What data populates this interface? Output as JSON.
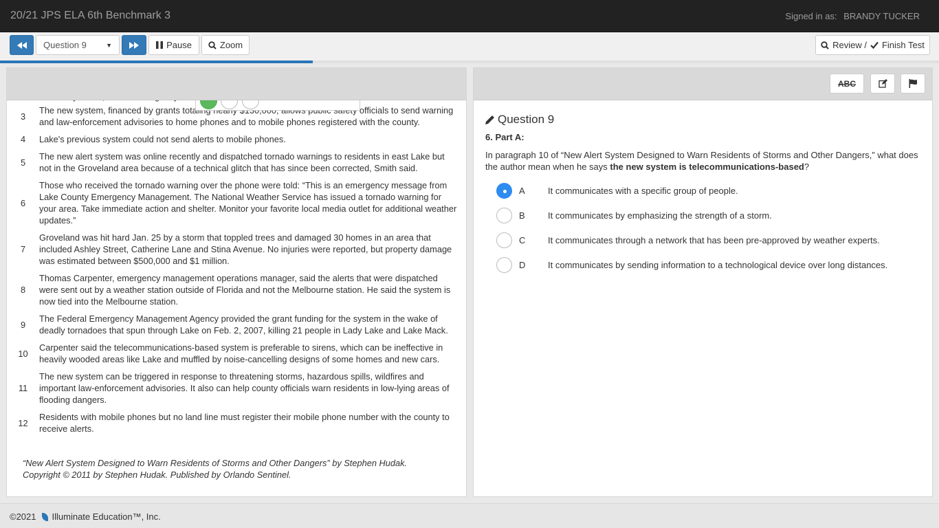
{
  "header": {
    "title": "20/21 JPS ELA 6th Benchmark 3",
    "signed_in_label": "Signed in as:",
    "user_name": "BRANDY TUCKER"
  },
  "toolbar": {
    "prev_icon": "rewind-icon",
    "question_select": "Question 9",
    "next_icon": "fast-forward-icon",
    "pause_label": "Pause",
    "zoom_label": "Zoom",
    "review_label": "Review /",
    "finish_label": "Finish Test"
  },
  "progress": {
    "fraction": 0.333
  },
  "passage": {
    "cut_off_line": "said Jerry Smith, Lake's emergency man... ...tem's capabilities.",
    "paragraphs": [
      {
        "num": "3",
        "text": "The new system, financed by grants totaling nearly $130,000, allows public safety officials to send warning and law-enforcement advisories to home phones and to mobile phones registered with the county."
      },
      {
        "num": "4",
        "text": " Lake's previous system could not send alerts to mobile phones."
      },
      {
        "num": "5",
        "text": "The new alert system was online recently and dispatched tornado warnings to residents in east Lake but not in the Groveland area because of a technical glitch that has since been corrected, Smith said."
      },
      {
        "num": "6",
        "text": "Those who received the tornado warning over the phone were told: “This is an emergency message from Lake County Emergency Management. The National Weather Service has issued a tornado warning for your area. Take immediate action and shelter. Monitor your favorite local media outlet for additional weather updates.”"
      },
      {
        "num": "7",
        "text": "Groveland was hit hard Jan. 25 by a storm that toppled trees and damaged 30 homes in an area that included Ashley Street, Catherine Lane and Stina Avenue. No injuries were reported, but property damage was estimated between $500,000 and $1 million."
      },
      {
        "num": "8",
        "text": "Thomas Carpenter, emergency management operations manager, said the alerts that were dispatched were sent out by a weather station outside of Florida and not the Melbourne station. He said the system is now tied into the Melbourne station."
      },
      {
        "num": "9",
        "text": "The Federal Emergency Management Agency provided the grant funding for the system in the wake of deadly tornadoes that spun through Lake on Feb. 2, 2007, killing 21 people in Lady Lake and Lake Mack."
      },
      {
        "num": "10",
        "text": "Carpenter said the telecommunications-based system is preferable to sirens, which can be ineffective in heavily wooded areas like Lake and muffled by noise-cancelling designs of some homes and new cars."
      },
      {
        "num": "11",
        "text": "The new system can be triggered in response to threatening storms, hazardous spills, wildfires and important law-enforcement advisories. It also can help county officials warn residents in low-lying areas of flooding dangers."
      },
      {
        "num": "12",
        "text": "Residents with mobile phones but no land line must register their mobile phone number with the county to receive alerts."
      }
    ],
    "citation_line1": "“New Alert System Designed to Warn Residents of Storms and Other Dangers” by Stephen Hudak.",
    "citation_line2": "Copyright © 2011 by Stephen Hudak. Published by Orlando Sentinel."
  },
  "tools": {
    "abc_label": "ABC",
    "notes_icon": "edit-icon",
    "flag_icon": "flag-icon"
  },
  "question": {
    "title": "Question 9",
    "part": "6. Part A:",
    "stem_before": "In paragraph 10 of “New Alert System Designed to Warn Residents of Storms and Other Dangers,” what does the author mean when he says ",
    "stem_bold": "the new system is telecommunications-based",
    "stem_after": "?",
    "options": [
      {
        "letter": "A",
        "text": "It communicates with a specific group of people.",
        "selected": true
      },
      {
        "letter": "B",
        "text": "It communicates by emphasizing the strength of a storm.",
        "selected": false
      },
      {
        "letter": "C",
        "text": "It communicates through a network that has been pre-approved by weather experts.",
        "selected": false
      },
      {
        "letter": "D",
        "text": "It communicates by sending information to a technological device over long distances.",
        "selected": false
      }
    ]
  },
  "footer": {
    "copyright": "©2021",
    "company": "Illuminate Education™, Inc."
  },
  "colors": {
    "primary": "#337ab7",
    "selected": "#2d8cf0",
    "header_bg": "#222222"
  }
}
